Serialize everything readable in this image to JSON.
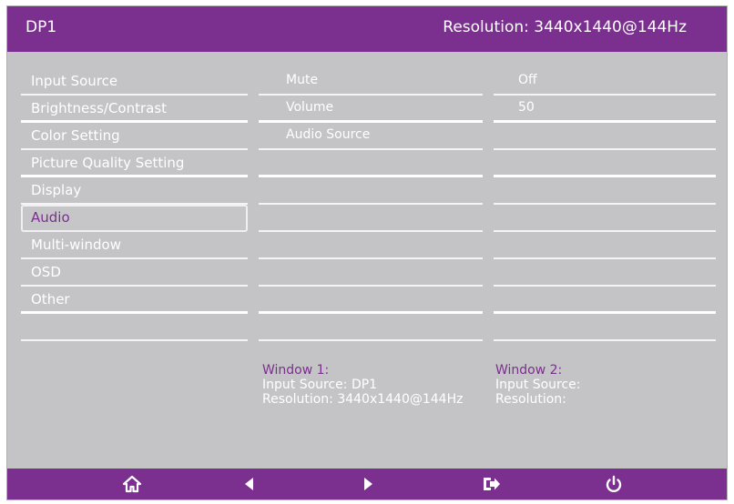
{
  "header": {
    "input": "DP1",
    "resolution": "Resolution: 3440x1440@144Hz"
  },
  "menu": [
    "Input Source",
    "Brightness/Contrast",
    "Color Setting",
    "Picture Quality Setting",
    "Display",
    "Audio",
    "Multi-window",
    "OSD",
    "Other"
  ],
  "selected_menu": "Audio",
  "submenu": [
    "Mute",
    "Volume",
    "Audio Source"
  ],
  "values": [
    "Off",
    "50"
  ],
  "window1": {
    "title": "Window 1:",
    "input": "Input Source: DP1",
    "resolution": "Resolution: 3440x1440@144Hz"
  },
  "window2": {
    "title": "Window 2:",
    "input": "Input Source:",
    "resolution": "Resolution:"
  },
  "footer_icons": [
    "home-icon",
    "left-arrow-icon",
    "right-arrow-icon",
    "exit-icon",
    "power-icon"
  ],
  "colors": {
    "accent": "#7b2f8f",
    "panel": "#c4c4c6",
    "text": "#ffffff"
  }
}
